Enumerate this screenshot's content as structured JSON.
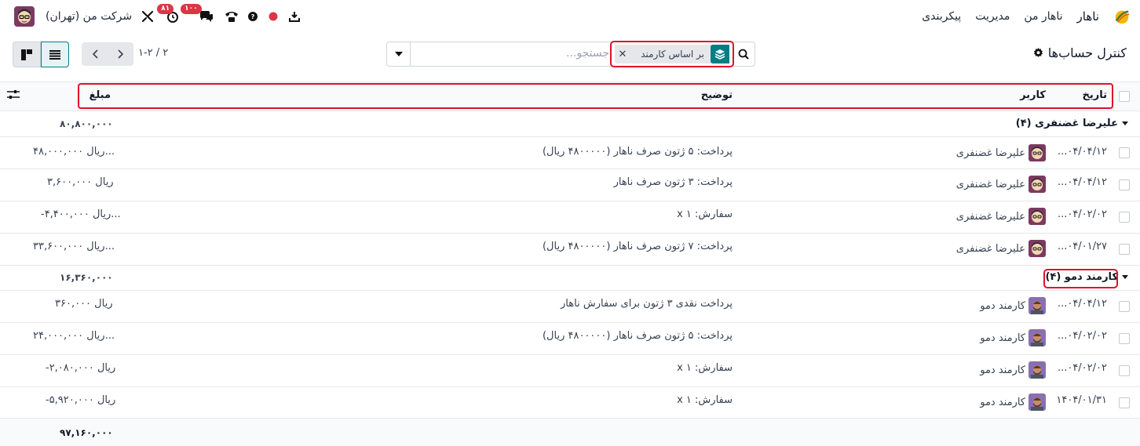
{
  "navbar": {
    "app_name": "ناهار",
    "menu": [
      "ناهار من",
      "مدیریت",
      "پیکربندی"
    ],
    "company": "شرکت من (تهران)",
    "activity_badge": "۸۱",
    "messages_badge": "۱۰۰"
  },
  "control_panel": {
    "title": "کنترل حساب‌ها",
    "search": {
      "placeholder": "جستجو...",
      "facet_label": "بر اساس کارمند"
    },
    "pager": "۱-۲ / ۲"
  },
  "table": {
    "headers": {
      "date": "تاریخ",
      "user": "کاربر",
      "description": "توضیح",
      "amount": "مبلغ"
    },
    "groups": [
      {
        "name": "علیرضا غضنفری (۴)",
        "total": "۸۰,۸۰۰,۰۰۰",
        "rows": [
          {
            "date": "...۰۴/۰۴/۱۲",
            "user": "علیرضا غضنفری",
            "description": "پرداخت: ۵ ژتون صرف ناهار (۴۸۰۰۰۰۰ ریال)",
            "amount": "۴۸,۰۰۰,۰۰۰ ریال..."
          },
          {
            "date": "...۰۴/۰۴/۱۲",
            "user": "علیرضا غضنفری",
            "description": "پرداخت: ۳ ژتون صرف ناهار",
            "amount": "۳,۶۰۰,۰۰۰ ریال"
          },
          {
            "date": "...۰۴/۰۲/۰۲",
            "user": "علیرضا غضنفری",
            "description": "سفارش: ۱ x",
            "amount": "-۴,۴۰۰,۰۰۰ ریال..."
          },
          {
            "date": "...۰۴/۰۱/۲۷",
            "user": "علیرضا غضنفری",
            "description": "پرداخت: ۷ ژتون صرف ناهار (۴۸۰۰۰۰۰ ریال)",
            "amount": "۳۳,۶۰۰,۰۰۰ ریال..."
          }
        ]
      },
      {
        "name": "کارمند دمو (۴)",
        "total": "۱۶,۳۶۰,۰۰۰",
        "rows": [
          {
            "date": "...۰۴/۰۴/۱۲",
            "user": "کارمند دمو",
            "description": "پرداخت نقدی ۳ ژتون برای سفارش ناهار",
            "amount": "۳۶۰,۰۰۰ ریال"
          },
          {
            "date": "...۰۴/۰۲/۰۲",
            "user": "کارمند دمو",
            "description": "پرداخت: ۵ ژتون صرف ناهار (۴۸۰۰۰۰۰ ریال)",
            "amount": "۲۴,۰۰۰,۰۰۰ ریال..."
          },
          {
            "date": "...۰۴/۰۲/۰۲",
            "user": "کارمند دمو",
            "description": "سفارش: ۱ x",
            "amount": "-۲,۰۸۰,۰۰۰ ریال"
          },
          {
            "date": "۱۴۰۴/۰۱/۳۱",
            "user": "کارمند دمو",
            "description": "سفارش: ۱ x",
            "amount": "-۵,۹۲۰,۰۰۰ ریال"
          }
        ]
      }
    ],
    "grand_total": "۹۷,۱۶۰,۰۰۰"
  }
}
